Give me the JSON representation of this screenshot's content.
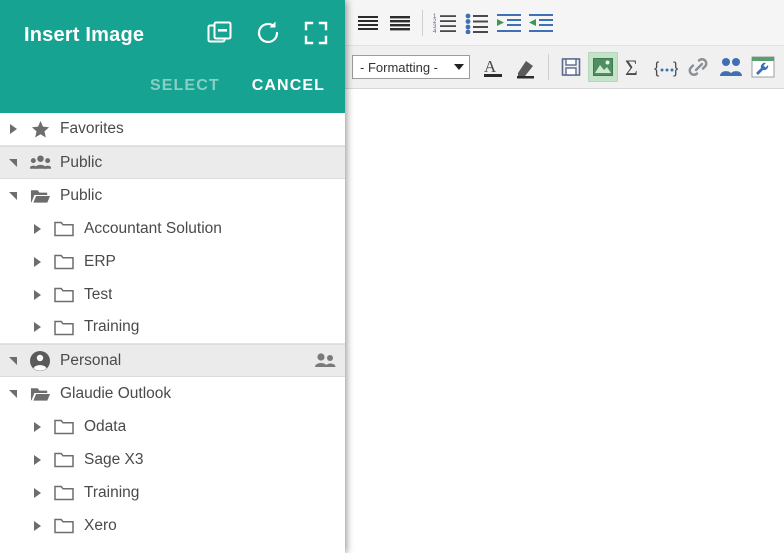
{
  "modal": {
    "title": "Insert Image",
    "header_icons": [
      {
        "name": "duplicate-remove-icon",
        "label": "Remove"
      },
      {
        "name": "refresh-icon",
        "label": "Refresh"
      },
      {
        "name": "fullscreen-icon",
        "label": "Fullscreen"
      }
    ],
    "actions": {
      "select_label": "SELECT",
      "select_enabled": false,
      "cancel_label": "CANCEL",
      "cancel_enabled": true
    },
    "accent_color": "#17a391",
    "group_row_bg": "#ebebeb"
  },
  "tree": {
    "nodes": [
      {
        "label": "Favorites",
        "icon": "star-icon",
        "expanded": false,
        "indent": 1,
        "type": "group",
        "right_icon": null
      },
      {
        "label": "Public",
        "icon": "people-icon",
        "expanded": true,
        "indent": 1,
        "type": "group",
        "right_icon": null
      },
      {
        "label": "Public",
        "icon": "folder-open-icon",
        "expanded": true,
        "indent": 1,
        "type": "folder",
        "right_icon": null
      },
      {
        "label": "Accountant Solution",
        "icon": "folder-icon",
        "expanded": false,
        "indent": 2,
        "type": "folder",
        "right_icon": null
      },
      {
        "label": "ERP",
        "icon": "folder-icon",
        "expanded": false,
        "indent": 2,
        "type": "folder",
        "right_icon": null
      },
      {
        "label": "Test",
        "icon": "folder-icon",
        "expanded": false,
        "indent": 2,
        "type": "folder",
        "right_icon": null
      },
      {
        "label": "Training",
        "icon": "folder-icon",
        "expanded": false,
        "indent": 2,
        "type": "folder",
        "right_icon": null
      },
      {
        "label": "Personal",
        "icon": "account-icon",
        "expanded": true,
        "indent": 1,
        "type": "group",
        "right_icon": "share-people-icon"
      },
      {
        "label": "Glaudie Outlook",
        "icon": "folder-open-icon",
        "expanded": true,
        "indent": 1,
        "type": "folder",
        "right_icon": null
      },
      {
        "label": "Odata",
        "icon": "folder-icon",
        "expanded": false,
        "indent": 2,
        "type": "folder",
        "right_icon": null
      },
      {
        "label": "Sage X3",
        "icon": "folder-icon",
        "expanded": false,
        "indent": 2,
        "type": "folder",
        "right_icon": null
      },
      {
        "label": "Training",
        "icon": "folder-icon",
        "expanded": false,
        "indent": 2,
        "type": "folder",
        "right_icon": null
      },
      {
        "label": "Xero",
        "icon": "folder-icon",
        "expanded": false,
        "indent": 2,
        "type": "folder",
        "right_icon": null
      }
    ]
  },
  "toolbar": {
    "row1": [
      {
        "name": "align-justify-icon",
        "label": "Justify"
      },
      {
        "name": "align-full-icon",
        "label": "Align"
      },
      {
        "name": "ordered-list-icon",
        "label": "Numbered list"
      },
      {
        "name": "unordered-list-icon",
        "label": "Bulleted list"
      },
      {
        "name": "indent-increase-icon",
        "label": "Increase indent"
      },
      {
        "name": "indent-decrease-icon",
        "label": "Decrease indent"
      }
    ],
    "format_select": {
      "value": "- Formatting -",
      "options": [
        "- Formatting -"
      ]
    },
    "row2": [
      {
        "name": "font-color-icon",
        "label": "Font color",
        "active": false
      },
      {
        "name": "highlight-icon",
        "label": "Highlight",
        "active": false
      },
      {
        "name": "save-icon",
        "label": "Save",
        "active": false
      },
      {
        "name": "insert-image-icon",
        "label": "Insert image",
        "active": true
      },
      {
        "name": "sigma-icon",
        "label": "Formula",
        "active": false
      },
      {
        "name": "placeholder-icon",
        "label": "Placeholder",
        "active": false
      },
      {
        "name": "link-icon",
        "label": "Insert link",
        "active": false
      },
      {
        "name": "contacts-icon",
        "label": "Contacts",
        "active": false
      },
      {
        "name": "tools-icon",
        "label": "Tools",
        "active": false
      }
    ]
  }
}
